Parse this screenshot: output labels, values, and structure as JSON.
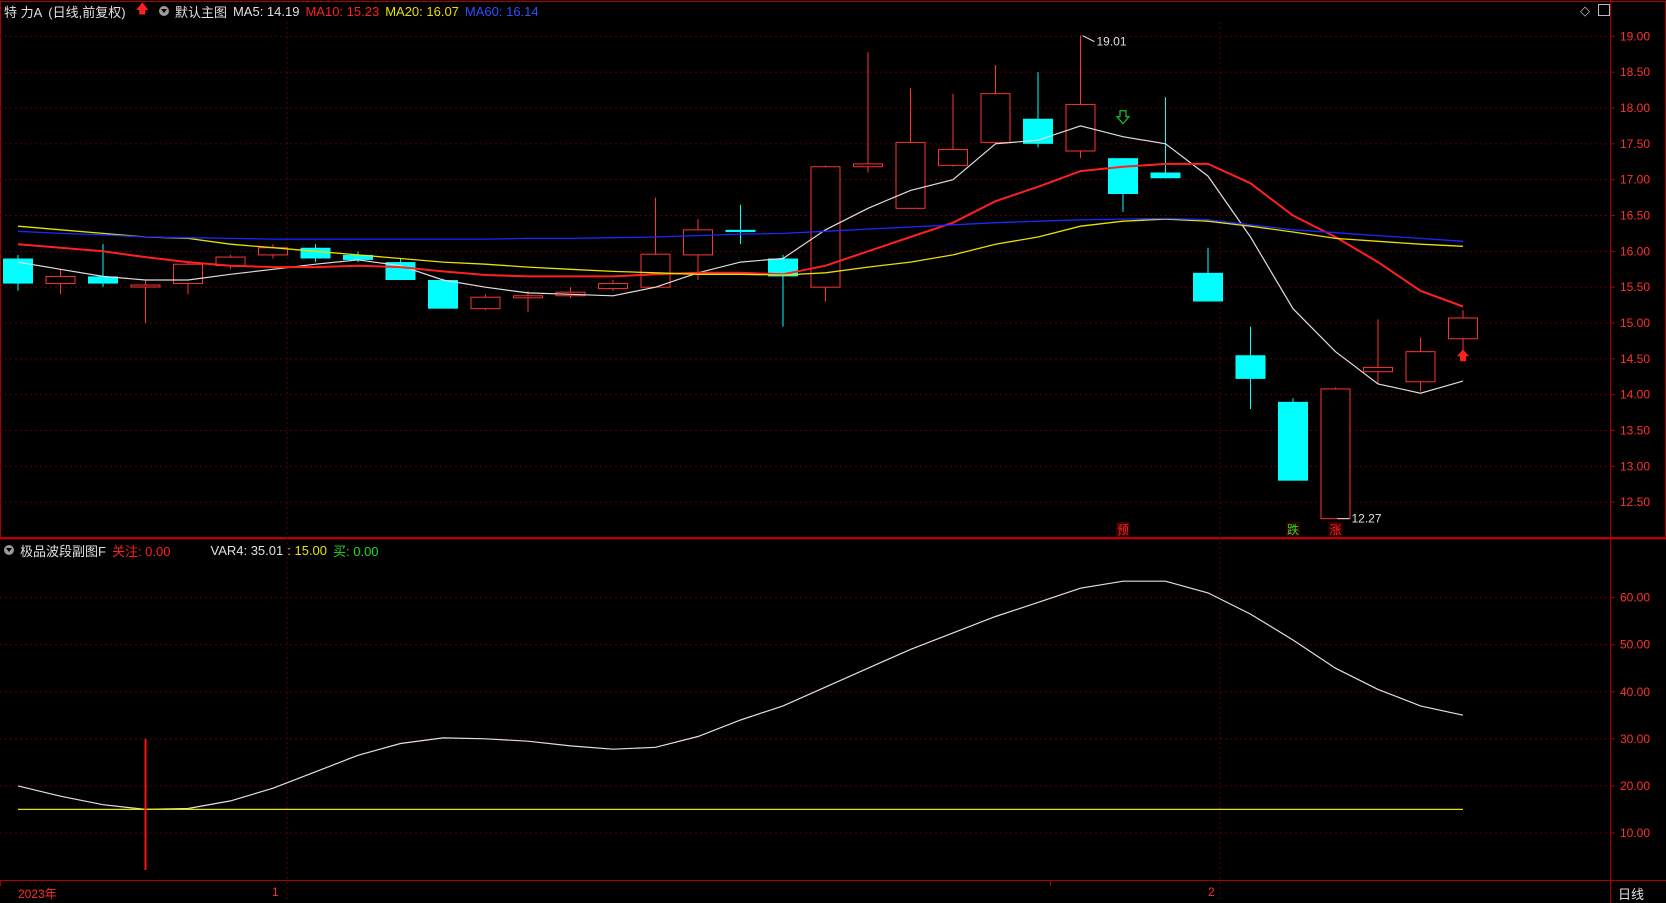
{
  "header": {
    "stock_name": "特 力A",
    "mode": "(日线,前复权)",
    "template": "默认主图",
    "ma5": "MA5: 14.19",
    "ma10": "MA10: 15.23",
    "ma20": "MA20: 16.07",
    "ma60": "MA60: 16.14"
  },
  "sub_header": {
    "indicator": "极品波段副图F",
    "focus": "关注: 0.00",
    "var4_label": "VAR4: 35.01",
    "var_15": ": 15.00",
    "buy": "买: 0.00"
  },
  "colors": {
    "up": "#ff3232",
    "down": "#00ffff",
    "ma5": "#dddddd",
    "ma10": "#ff2020",
    "ma20": "#e8e000",
    "ma60": "#1a28ff",
    "axis": "#aa0000",
    "grid": "#5a0000"
  },
  "footer": {
    "year_label": "2023年",
    "month_1": "1",
    "month_2": "2",
    "period": "日线"
  },
  "chart_data": [
    {
      "type": "candlestick",
      "title": "",
      "ylim": [
        12.0,
        19.2
      ],
      "y_ticks": [
        "19.00",
        "18.50",
        "18.00",
        "17.50",
        "17.00",
        "16.50",
        "16.00",
        "15.50",
        "15.00",
        "14.50",
        "14.00",
        "13.50",
        "13.00",
        "12.50"
      ],
      "candles": [
        {
          "o": 15.9,
          "h": 15.95,
          "l": 15.45,
          "c": 15.55
        },
        {
          "o": 15.55,
          "h": 15.75,
          "l": 15.4,
          "c": 15.65
        },
        {
          "o": 15.65,
          "h": 16.1,
          "l": 15.5,
          "c": 15.55
        },
        {
          "o": 15.52,
          "h": 15.6,
          "l": 15.0,
          "c": 15.53
        },
        {
          "o": 15.55,
          "h": 15.85,
          "l": 15.4,
          "c": 15.82
        },
        {
          "o": 15.8,
          "h": 15.95,
          "l": 15.75,
          "c": 15.92
        },
        {
          "o": 15.95,
          "h": 16.1,
          "l": 15.9,
          "c": 16.05
        },
        {
          "o": 16.05,
          "h": 16.1,
          "l": 15.85,
          "c": 15.9
        },
        {
          "o": 15.95,
          "h": 16.0,
          "l": 15.85,
          "c": 15.88
        },
        {
          "o": 15.85,
          "h": 15.9,
          "l": 15.6,
          "c": 15.6
        },
        {
          "o": 15.6,
          "h": 15.62,
          "l": 15.2,
          "c": 15.2
        },
        {
          "o": 15.2,
          "h": 15.4,
          "l": 15.18,
          "c": 15.36
        },
        {
          "o": 15.36,
          "h": 15.45,
          "l": 15.15,
          "c": 15.38
        },
        {
          "o": 15.38,
          "h": 15.5,
          "l": 15.35,
          "c": 15.43
        },
        {
          "o": 15.48,
          "h": 15.6,
          "l": 15.45,
          "c": 15.55
        },
        {
          "o": 15.5,
          "h": 16.75,
          "l": 15.5,
          "c": 15.96
        },
        {
          "o": 15.95,
          "h": 16.45,
          "l": 15.6,
          "c": 16.3
        },
        {
          "o": 16.3,
          "h": 16.65,
          "l": 16.1,
          "c": 16.27
        },
        {
          "o": 15.9,
          "h": 15.95,
          "l": 14.95,
          "c": 15.65
        },
        {
          "o": 15.5,
          "h": 17.2,
          "l": 15.3,
          "c": 17.18
        },
        {
          "o": 17.18,
          "h": 18.78,
          "l": 17.1,
          "c": 17.22
        },
        {
          "o": 16.6,
          "h": 18.28,
          "l": 16.6,
          "c": 17.52
        },
        {
          "o": 17.2,
          "h": 18.2,
          "l": 17.18,
          "c": 17.42
        },
        {
          "o": 17.52,
          "h": 18.6,
          "l": 17.5,
          "c": 18.2
        },
        {
          "o": 17.85,
          "h": 18.5,
          "l": 17.45,
          "c": 17.5
        },
        {
          "o": 17.4,
          "h": 19.01,
          "l": 17.3,
          "c": 18.05
        },
        {
          "o": 17.3,
          "h": 17.3,
          "l": 16.55,
          "c": 16.8
        },
        {
          "o": 17.1,
          "h": 18.15,
          "l": 17.02,
          "c": 17.02
        },
        {
          "o": 15.7,
          "h": 16.05,
          "l": 15.3,
          "c": 15.3
        },
        {
          "o": 14.55,
          "h": 14.95,
          "l": 13.8,
          "c": 14.22
        },
        {
          "o": 13.9,
          "h": 13.95,
          "l": 12.8,
          "c": 12.8
        },
        {
          "o": 12.27,
          "h": 14.1,
          "l": 12.27,
          "c": 14.08
        },
        {
          "o": 14.32,
          "h": 15.05,
          "l": 14.15,
          "c": 14.38
        },
        {
          "o": 14.18,
          "h": 14.8,
          "l": 14.05,
          "c": 14.6
        },
        {
          "o": 14.78,
          "h": 15.18,
          "l": 14.55,
          "c": 15.07
        }
      ],
      "series": [
        {
          "name": "MA5",
          "values": [
            15.85,
            15.75,
            15.65,
            15.6,
            15.6,
            15.68,
            15.75,
            15.82,
            15.88,
            15.8,
            15.6,
            15.5,
            15.42,
            15.4,
            15.38,
            15.5,
            15.7,
            15.85,
            15.9,
            16.3,
            16.6,
            16.85,
            17.0,
            17.5,
            17.55,
            17.75,
            17.6,
            17.5,
            17.05,
            16.2,
            15.2,
            14.6,
            14.15,
            14.02,
            14.19
          ]
        },
        {
          "name": "MA10",
          "values": [
            16.1,
            16.05,
            16.0,
            15.92,
            15.85,
            15.8,
            15.78,
            15.78,
            15.8,
            15.78,
            15.72,
            15.67,
            15.65,
            15.65,
            15.65,
            15.68,
            15.7,
            15.7,
            15.68,
            15.8,
            16.0,
            16.2,
            16.4,
            16.7,
            16.9,
            17.12,
            17.18,
            17.22,
            17.22,
            16.95,
            16.5,
            16.2,
            15.85,
            15.45,
            15.23
          ]
        },
        {
          "name": "MA20",
          "values": [
            16.35,
            16.3,
            16.25,
            16.2,
            16.18,
            16.1,
            16.05,
            16.0,
            15.95,
            15.9,
            15.85,
            15.82,
            15.78,
            15.75,
            15.72,
            15.7,
            15.68,
            15.68,
            15.67,
            15.7,
            15.78,
            15.85,
            15.95,
            16.1,
            16.2,
            16.35,
            16.42,
            16.45,
            16.42,
            16.35,
            16.27,
            16.18,
            16.14,
            16.1,
            16.07
          ]
        },
        {
          "name": "MA60",
          "values": [
            16.28,
            16.25,
            16.23,
            16.2,
            16.19,
            16.18,
            16.17,
            16.17,
            16.17,
            16.17,
            16.17,
            16.17,
            16.18,
            16.18,
            16.19,
            16.2,
            16.22,
            16.24,
            16.25,
            16.28,
            16.31,
            16.34,
            16.37,
            16.4,
            16.42,
            16.44,
            16.45,
            16.46,
            16.44,
            16.37,
            16.3,
            16.26,
            16.22,
            16.18,
            16.14
          ]
        }
      ],
      "annotations": [
        {
          "index": 25,
          "value": 19.01,
          "label": "19.01",
          "pos": "right-top"
        },
        {
          "index": 31,
          "value": 12.27,
          "label": "12.27",
          "pos": "right-bottom"
        }
      ],
      "signal_labels": [
        {
          "index": 26,
          "text": "预",
          "color": "#ff2020"
        },
        {
          "index": 30,
          "text": "跌",
          "color": "#20dd20"
        },
        {
          "index": 31,
          "text": "涨",
          "color": "#ff2020"
        }
      ],
      "arrows": [
        {
          "index": 26,
          "value": 17.85,
          "dir": "down",
          "color": "#20c020"
        },
        {
          "index": 34,
          "value": 14.55,
          "dir": "up",
          "color": "#ff2020"
        }
      ]
    },
    {
      "type": "line",
      "title": "",
      "ylim": [
        0,
        68
      ],
      "y_ticks": [
        "60.00",
        "50.00",
        "40.00",
        "30.00",
        "20.00",
        "10.00"
      ],
      "series": [
        {
          "name": "VAR4",
          "values": [
            20.0,
            17.8,
            16.0,
            15.0,
            15.2,
            16.8,
            19.5,
            23.0,
            26.5,
            29.0,
            30.2,
            30.0,
            29.5,
            28.5,
            27.8,
            28.2,
            30.5,
            34.0,
            37.0,
            41.0,
            45.0,
            49.0,
            52.5,
            56.0,
            59.0,
            62.0,
            63.5,
            63.5,
            61.0,
            56.5,
            51.0,
            45.0,
            40.5,
            37.0,
            35.01
          ]
        },
        {
          "name": "15.00",
          "values": [
            15,
            15,
            15,
            15,
            15,
            15,
            15,
            15,
            15,
            15,
            15,
            15,
            15,
            15,
            15,
            15,
            15,
            15,
            15,
            15,
            15,
            15,
            15,
            15,
            15,
            15,
            15,
            15,
            15,
            15,
            15,
            15,
            15,
            15,
            15
          ]
        }
      ],
      "bar_signals": [
        {
          "index": 3,
          "top": 30.0,
          "bottom": 0,
          "color": "#ff1010"
        }
      ]
    }
  ]
}
